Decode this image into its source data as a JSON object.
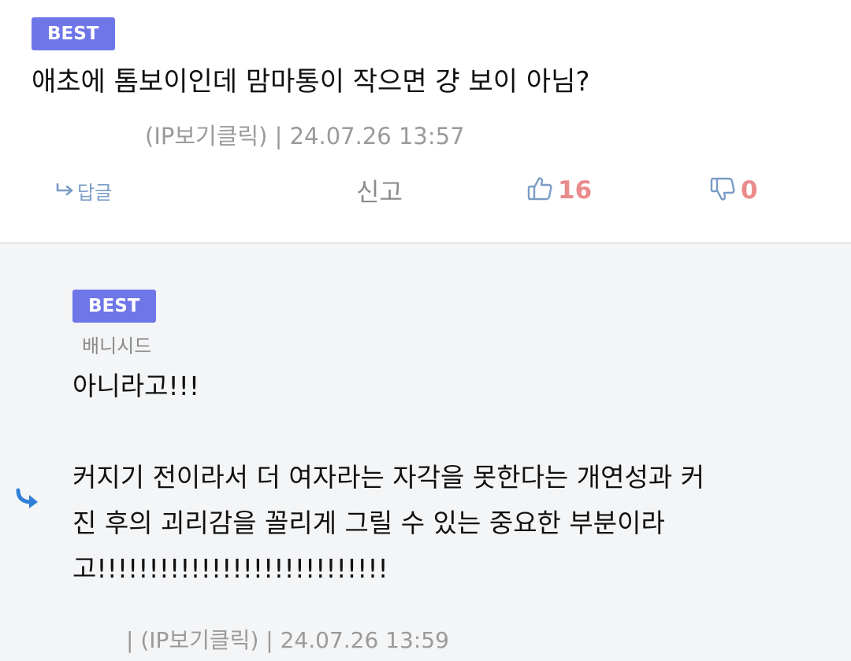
{
  "top_comment": {
    "badge": "BEST",
    "text": "애초에 톰보이인데 맘마통이 작으면 걍 보이 아님?",
    "meta": "(IP보기클릭) | 24.07.26 13:57",
    "reply_label": "답글",
    "report_label": "신고",
    "likes": "16",
    "dislikes": "0"
  },
  "reply_comment": {
    "badge": "BEST",
    "nickname": "배니시드",
    "lines": [
      "아니라고!!!",
      "",
      "커지기 전이라서 더 여자라는 자각을 못한다는 개연성과 커",
      "진 후의 괴리감을 꼴리게 그릴 수 있는 중요한 부분이라",
      "고!!!!!!!!!!!!!!!!!!!!!!!!!!!!"
    ],
    "meta": "| (IP보기클릭) | 24.07.26 13:59"
  },
  "colors": {
    "badge": "#6e76e8",
    "count": "#ea8a8a",
    "icon_blue": "#7a9cc6",
    "reply_bg": "#f4f5f7",
    "reply_arrow": "#2f7fd8"
  }
}
